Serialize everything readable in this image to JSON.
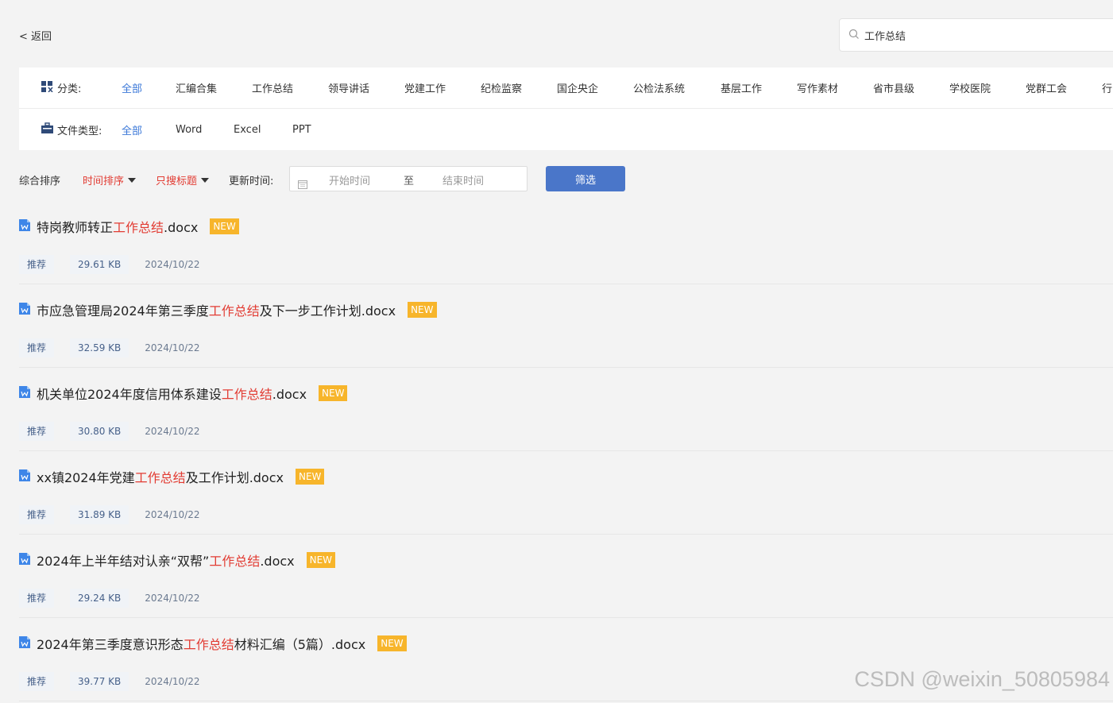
{
  "header": {
    "back_label": "< 返回",
    "search_value": "工作总结"
  },
  "filters": {
    "category_label": "分类:",
    "categories": [
      "全部",
      "汇编合集",
      "工作总结",
      "领导讲话",
      "党建工作",
      "纪检监察",
      "国企央企",
      "公检法系统",
      "基层工作",
      "写作素材",
      "省市县级",
      "学校医院",
      "党群工会",
      "行"
    ],
    "filetype_label": "文件类型:",
    "filetypes": [
      "全部",
      "Word",
      "Excel",
      "PPT"
    ]
  },
  "sort": {
    "comprehensive": "综合排序",
    "by_time": "时间排序",
    "title_only": "只搜标题",
    "update_time_label": "更新时间:",
    "start_placeholder": "开始时间",
    "to": "至",
    "end_placeholder": "结束时间",
    "filter_button": "筛选"
  },
  "results": [
    {
      "pre": "特岗教师转正",
      "hl": "工作总结",
      "post": ".docx",
      "badge": "NEW",
      "tag": "推荐",
      "size": "29.61 KB",
      "date": "2024/10/22"
    },
    {
      "pre": "市应急管理局2024年第三季度",
      "hl": "工作总结",
      "post": "及下一步工作计划.docx",
      "badge": "NEW",
      "tag": "推荐",
      "size": "32.59 KB",
      "date": "2024/10/22"
    },
    {
      "pre": "机关单位2024年度信用体系建设",
      "hl": "工作总结",
      "post": ".docx",
      "badge": "NEW",
      "tag": "推荐",
      "size": "30.80 KB",
      "date": "2024/10/22"
    },
    {
      "pre": "xx镇2024年党建",
      "hl": "工作总结",
      "post": "及工作计划.docx",
      "badge": "NEW",
      "tag": "推荐",
      "size": "31.89 KB",
      "date": "2024/10/22"
    },
    {
      "pre": "2024年上半年结对认亲“双帮”",
      "hl": "工作总结",
      "post": ".docx",
      "badge": "NEW",
      "tag": "推荐",
      "size": "29.24 KB",
      "date": "2024/10/22"
    },
    {
      "pre": "2024年第三季度意识形态",
      "hl": "工作总结",
      "post": "材料汇编（5篇）.docx",
      "badge": "NEW",
      "tag": "推荐",
      "size": "39.77 KB",
      "date": "2024/10/22"
    }
  ],
  "watermark": "CSDN @weixin_50805984"
}
